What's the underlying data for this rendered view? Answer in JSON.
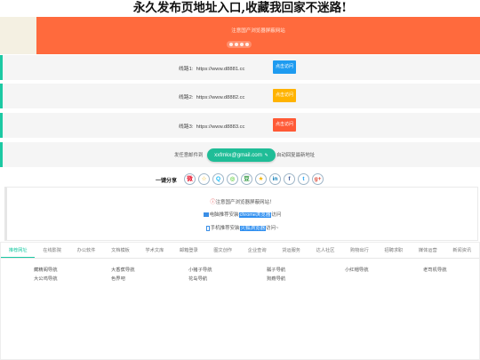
{
  "title": "永久发布页地址入口,收藏我回家不迷路!",
  "banner": {
    "text": "注意国产浏览器屏蔽网站",
    "dots": 4
  },
  "lines": [
    {
      "label": "线路1:",
      "url": "https://www.d8881.cc",
      "button": "点击访问",
      "color": "#1e9bf0"
    },
    {
      "label": "线路2:",
      "url": "https://www.d8882.cc",
      "button": "点击访问",
      "color": "#ffb300"
    },
    {
      "label": "线路3:",
      "url": "https://www.d8883.cc",
      "button": "点击访问",
      "color": "#ff5a36"
    }
  ],
  "mail": {
    "prefix": "发任意邮件到",
    "address_user": "xxfmkx",
    "address_at": "@",
    "address_domain": "gmail.com",
    "suffix": "自动回复最新地址"
  },
  "share": {
    "label": "一键分享",
    "icons": [
      {
        "name": "weibo-icon",
        "glyph": "微",
        "color": "#e6162d"
      },
      {
        "name": "qzone-icon",
        "glyph": "☆",
        "color": "#f5b400"
      },
      {
        "name": "qq-icon",
        "glyph": "Q",
        "color": "#12b7f5"
      },
      {
        "name": "wechat-icon",
        "glyph": "◎",
        "color": "#2dc100"
      },
      {
        "name": "douban-icon",
        "glyph": "豆",
        "color": "#2e963d"
      },
      {
        "name": "star-icon",
        "glyph": "★",
        "color": "#f5b400"
      },
      {
        "name": "linkedin-icon",
        "glyph": "in",
        "color": "#0077b5"
      },
      {
        "name": "facebook-icon",
        "glyph": "f",
        "color": "#3b5998"
      },
      {
        "name": "twitter-icon",
        "glyph": "t",
        "color": "#1da1f2"
      },
      {
        "name": "googleplus-icon",
        "glyph": "g+",
        "color": "#dd4b39"
      }
    ]
  },
  "notice": {
    "line1": "注意国产浏览器屏蔽网站！",
    "line2_prefix": "电脑推荐安装",
    "line2_highlight": "chrome浏览器",
    "line2_suffix": "访问",
    "line3_prefix": "手机推荐安装",
    "line3_highlight": "火狐浏览器",
    "line3_suffix": "访问~"
  },
  "tabs": [
    "推荐网址",
    "在线影院",
    "办公软件",
    "文档模板",
    "学术文库",
    "邮箱登录",
    "图文创作",
    "企业查询",
    "货运服务",
    "达人社区",
    "购物出行",
    "招聘求职",
    "媒体运营",
    "新闻资讯"
  ],
  "links": [
    "藏精阁导航",
    "大香蕉导航",
    "小猪子导航",
    "瓢子导航",
    "小红帽导航",
    "老司机导航",
    "大公鸡导航",
    "色界吧",
    "花岛导航",
    "狗瘾导航"
  ]
}
